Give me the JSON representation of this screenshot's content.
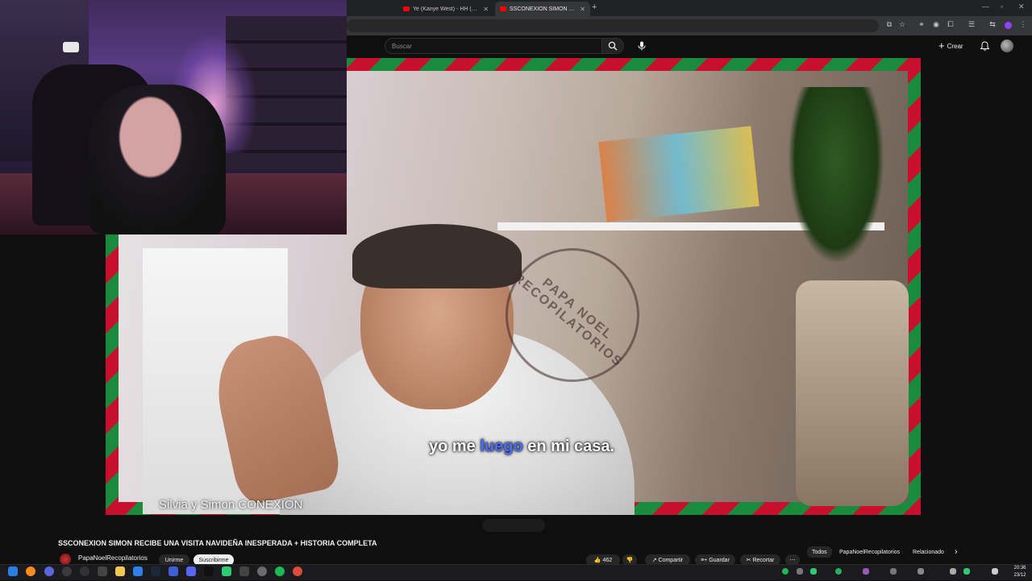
{
  "browser": {
    "tabs": [
      {
        "label": "Ye (Kanye West) - HH (Happy H",
        "active": false
      },
      {
        "label": "SSCONEXION SIMON RECIB",
        "active": true
      }
    ]
  },
  "header": {
    "search_placeholder": "Buscar",
    "create_label": "Crear"
  },
  "video": {
    "subtitle_before": "yo me ",
    "subtitle_highlight": "luego",
    "subtitle_after": " en mi casa.",
    "source_label": "Silvia y Simon CONEXION",
    "watermark": "PAPA NOEL RECOPILATORIOS",
    "title": "SSCONEXION SIMON RECIBE UNA VISITA NAVIDEÑA INESPERADA + HISTORIA COMPLETA",
    "channel_name": "PapaNoelRecopilatorios",
    "join_label": "Unirme",
    "subscribe_label": "Suscribirme",
    "like_count": "462",
    "share_label": "Compartir",
    "save_label": "Guardar",
    "clip_label": "Recortar"
  },
  "related_chips": {
    "all": "Todos",
    "channel": "PapaNoelRecopilatorios",
    "related": "Relacionado"
  },
  "taskbar": {
    "time": "20:36",
    "date": "23/12"
  },
  "colors": {
    "frame_red": "#c8102e",
    "frame_green": "#1a8a3c",
    "subtitle_highlight": "#4b6bff",
    "background": "#0f0f0f"
  }
}
